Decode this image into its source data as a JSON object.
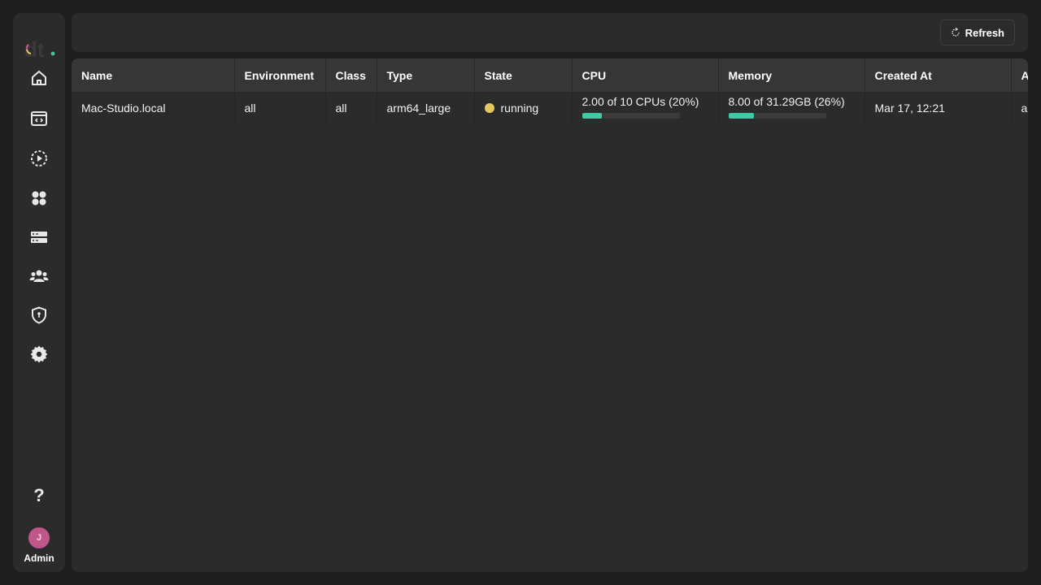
{
  "app": {
    "colors": {
      "accent": "#3fc9a5",
      "state_running": "#e5c762",
      "avatar": "#c0578a",
      "background": "#1e1e1e",
      "surface": "#2b2b2b"
    }
  },
  "sidebar": {
    "items": [
      {
        "name": "home",
        "icon": "home-icon"
      },
      {
        "name": "workspaces",
        "icon": "code-window-icon"
      },
      {
        "name": "jobs",
        "icon": "play-circle-icon"
      },
      {
        "name": "apps",
        "icon": "apps-grid-icon"
      },
      {
        "name": "servers",
        "icon": "server-icon"
      },
      {
        "name": "users",
        "icon": "users-icon"
      },
      {
        "name": "security",
        "icon": "shield-keyhole-icon"
      },
      {
        "name": "settings",
        "icon": "gear-icon"
      }
    ],
    "help_label": "?",
    "user": {
      "initial": "J",
      "role_label": "Admin"
    }
  },
  "toolbar": {
    "refresh_label": "Refresh"
  },
  "table": {
    "columns": [
      "Name",
      "Environment",
      "Class",
      "Type",
      "State",
      "CPU",
      "Memory",
      "Created At",
      "A"
    ],
    "rows": [
      {
        "name": "Mac-Studio.local",
        "environment": "all",
        "class": "all",
        "type": "arm64_large",
        "state": "running",
        "cpu": {
          "text": "2.00 of 10 CPUs (20%)",
          "fraction": 0.2
        },
        "memory": {
          "text": "8.00 of 31.29GB (26%)",
          "fraction": 0.26
        },
        "created_at": "Mar 17, 12:21",
        "extra": "ar"
      }
    ]
  }
}
